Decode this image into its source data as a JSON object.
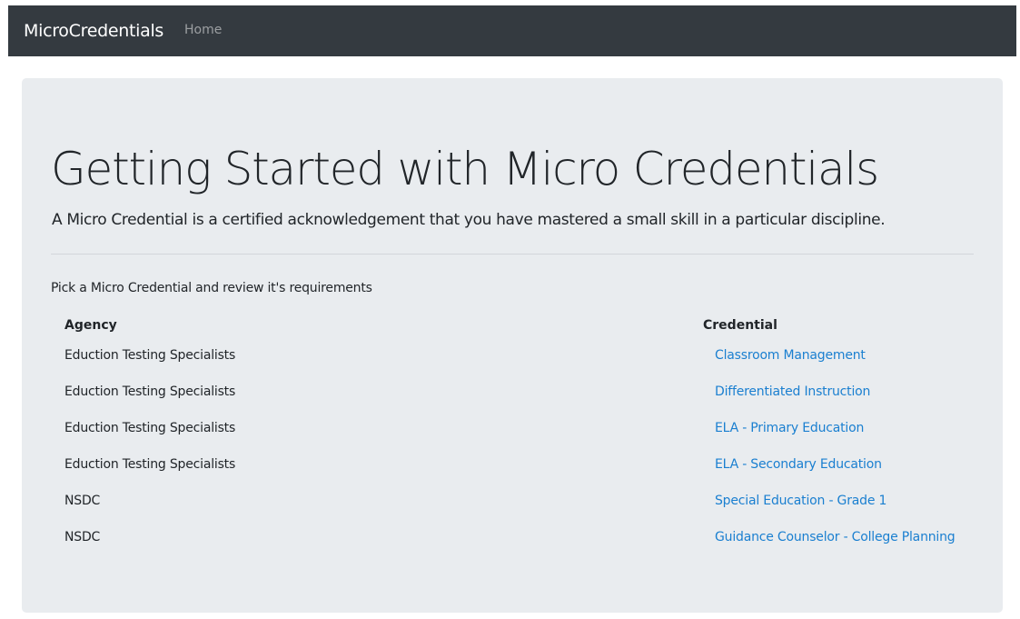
{
  "navbar": {
    "brand": "MicroCredentials",
    "links": [
      "Home"
    ]
  },
  "jumbotron": {
    "title": "Getting Started with Micro Credentials",
    "lead": "A Micro Credential is a certified acknowledgement that you have mastered a small skill in a particular discipline."
  },
  "main": {
    "intro": "Pick a Micro Credential and review it's requirements",
    "table": {
      "headers": {
        "agency": "Agency",
        "credential": "Credential"
      },
      "rows": [
        {
          "agency": "Eduction Testing Specialists",
          "credential": "Classroom Management"
        },
        {
          "agency": "Eduction Testing Specialists",
          "credential": "Differentiated Instruction"
        },
        {
          "agency": "Eduction Testing Specialists",
          "credential": "ELA - Primary Education"
        },
        {
          "agency": "Eduction Testing Specialists",
          "credential": "ELA - Secondary Education"
        },
        {
          "agency": "NSDC",
          "credential": "Special Education - Grade 1"
        },
        {
          "agency": "NSDC",
          "credential": "Guidance Counselor - College Planning"
        }
      ]
    }
  },
  "colors": {
    "navbar_bg": "#343a40",
    "jumbotron_bg": "#e9ecef",
    "link": "#1a7fd0"
  }
}
